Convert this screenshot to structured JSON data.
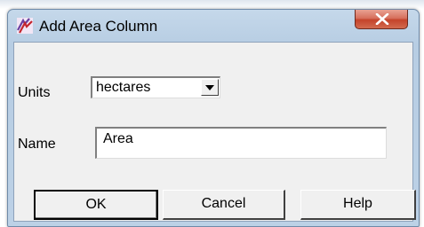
{
  "window": {
    "title": "Add Area Column",
    "close_icon": "close-x-icon",
    "app_icon": "area-tool-icon"
  },
  "form": {
    "units_label": "Units",
    "units_value": "hectares",
    "name_label": "Name",
    "name_value": "Area"
  },
  "buttons": {
    "ok_label": "OK",
    "cancel_label": "Cancel",
    "help_label": "Help"
  },
  "colors": {
    "title_gradient": "#b7cde3",
    "close_button": "#c4432a",
    "client_background": "#f0f0f0",
    "app_icon_primary": "#c4262e",
    "app_icon_secondary": "#6a3fa0"
  }
}
